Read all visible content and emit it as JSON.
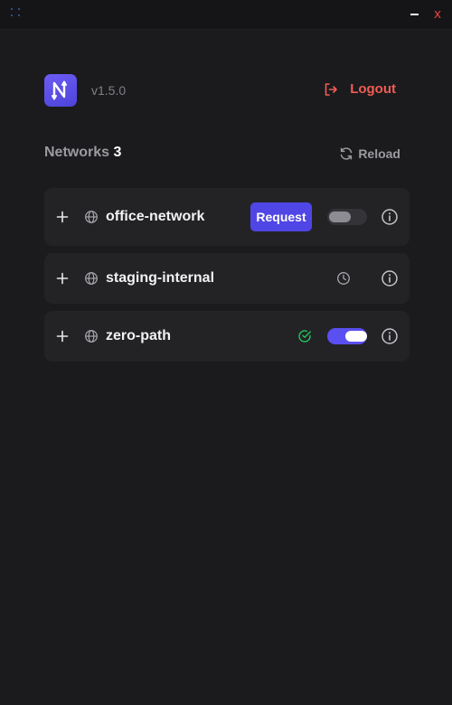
{
  "window": {
    "minimize_icon": "minimize-icon",
    "close_label": "x"
  },
  "header": {
    "logo_icon": "app-logo-icon",
    "version": "v1.5.0",
    "logout_label": "Logout",
    "logout_icon": "logout-icon",
    "logout_color": "#f25c54"
  },
  "networks": {
    "title": "Networks",
    "count": "3",
    "reload_label": "Reload",
    "reload_icon": "reload-icon",
    "items": [
      {
        "name": "office-network",
        "action_label": "Request",
        "toggle_on": false,
        "status_icon": null
      },
      {
        "name": "staging-internal",
        "action_label": null,
        "toggle_on": null,
        "status_icon": "clock-icon"
      },
      {
        "name": "zero-path",
        "action_label": null,
        "toggle_on": true,
        "status_icon": "check-circle-icon"
      }
    ]
  },
  "colors": {
    "accent": "#4f46e5",
    "success": "#22c55e",
    "danger": "#f25c54",
    "background": "#1b1b1d",
    "card": "#232326"
  }
}
